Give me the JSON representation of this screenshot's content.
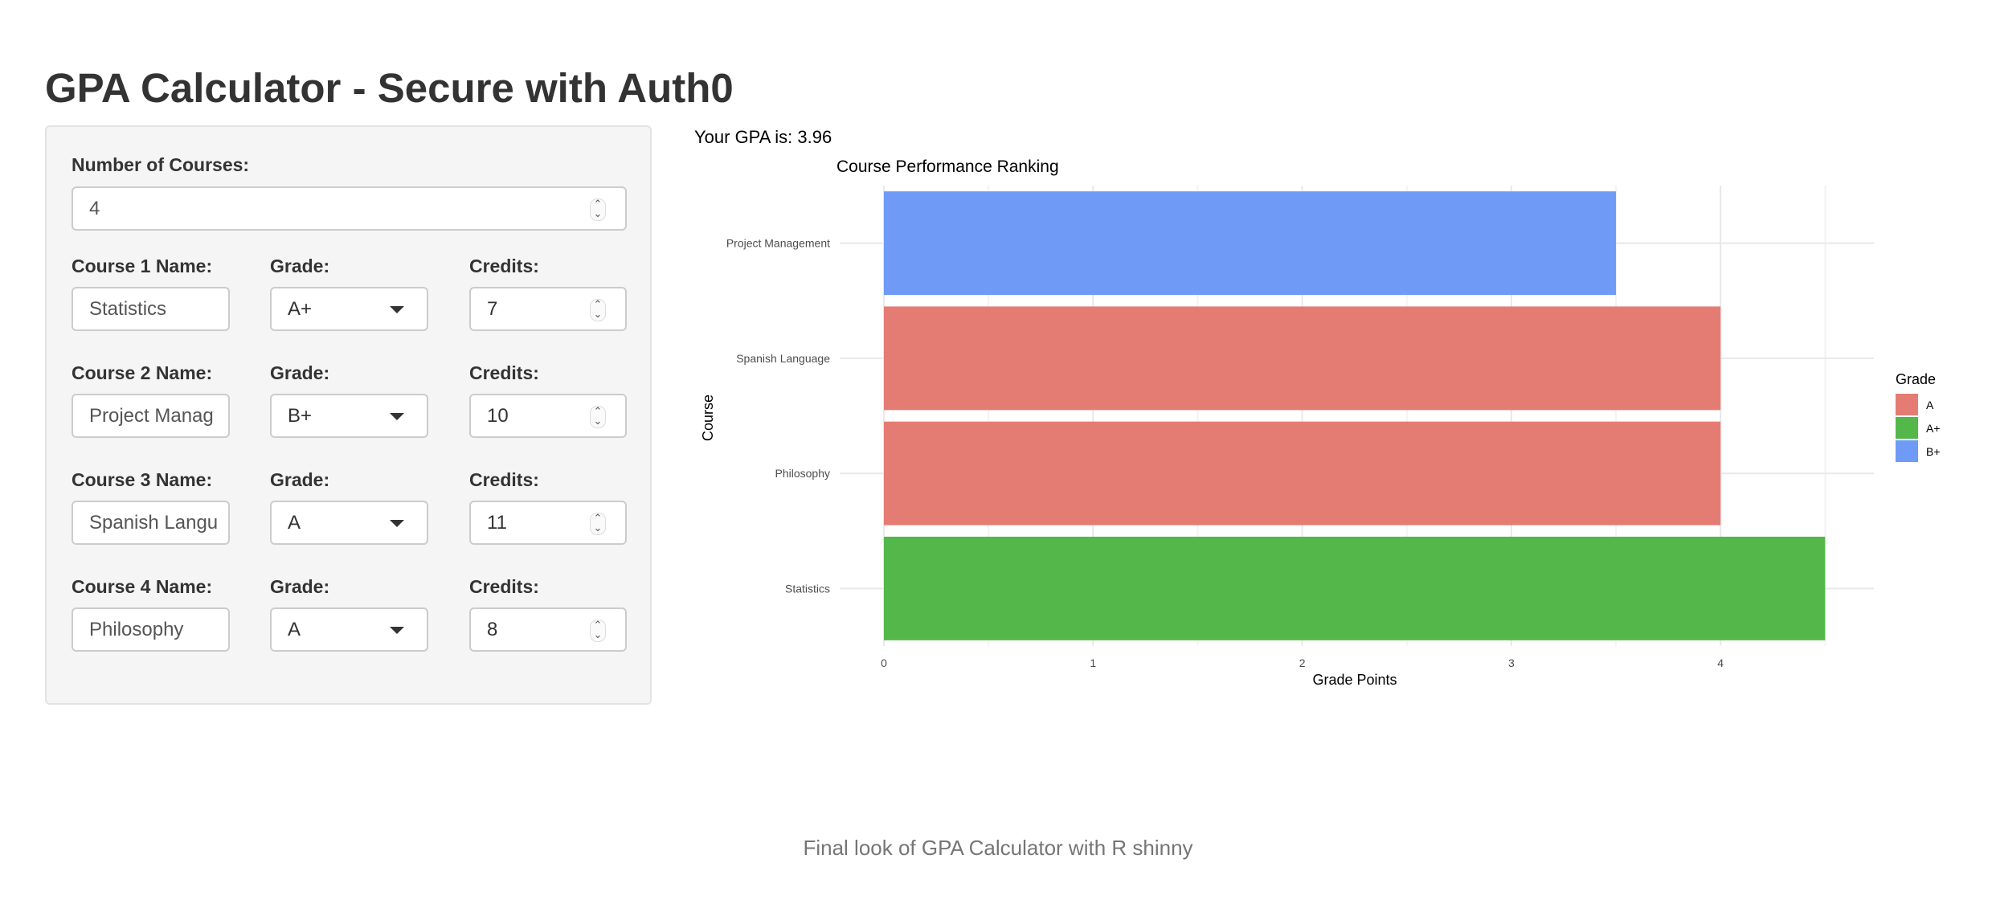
{
  "header": {
    "title": "GPA Calculator - Secure with Auth0"
  },
  "sidebar": {
    "num_courses_label": "Number of Courses:",
    "num_courses_value": "4",
    "grade_label": "Grade:",
    "credits_label": "Credits:",
    "courses": [
      {
        "name_label": "Course 1 Name:",
        "name": "Statistics",
        "grade": "A+",
        "credits": "7"
      },
      {
        "name_label": "Course 2 Name:",
        "name": "Project Manag",
        "grade": "B+",
        "credits": "10"
      },
      {
        "name_label": "Course 3 Name:",
        "name": "Spanish Langu",
        "grade": "A",
        "credits": "11"
      },
      {
        "name_label": "Course 4 Name:",
        "name": "Philosophy",
        "grade": "A",
        "credits": "8"
      }
    ]
  },
  "main": {
    "gpa_text": "Your GPA is: 3.96"
  },
  "chart_data": {
    "type": "bar",
    "orientation": "horizontal",
    "title": "Course Performance Ranking",
    "xlabel": "Grade Points",
    "ylabel": "Course",
    "categories": [
      "Statistics",
      "Philosophy",
      "Spanish Language",
      "Project Management"
    ],
    "values": [
      4.5,
      4,
      4,
      3.5
    ],
    "grades": [
      "A+",
      "A",
      "A",
      "B+"
    ],
    "xlim": [
      0,
      4.7
    ],
    "xticks": [
      0,
      1,
      2,
      3,
      4
    ],
    "grid": true,
    "legend": {
      "title": "Grade",
      "position": "right",
      "entries": [
        {
          "label": "A",
          "color": "#E57C73"
        },
        {
          "label": "A+",
          "color": "#54B74A"
        },
        {
          "label": "B+",
          "color": "#6F9AF6"
        }
      ]
    }
  },
  "caption": "Final look of GPA Calculator with R shinny"
}
